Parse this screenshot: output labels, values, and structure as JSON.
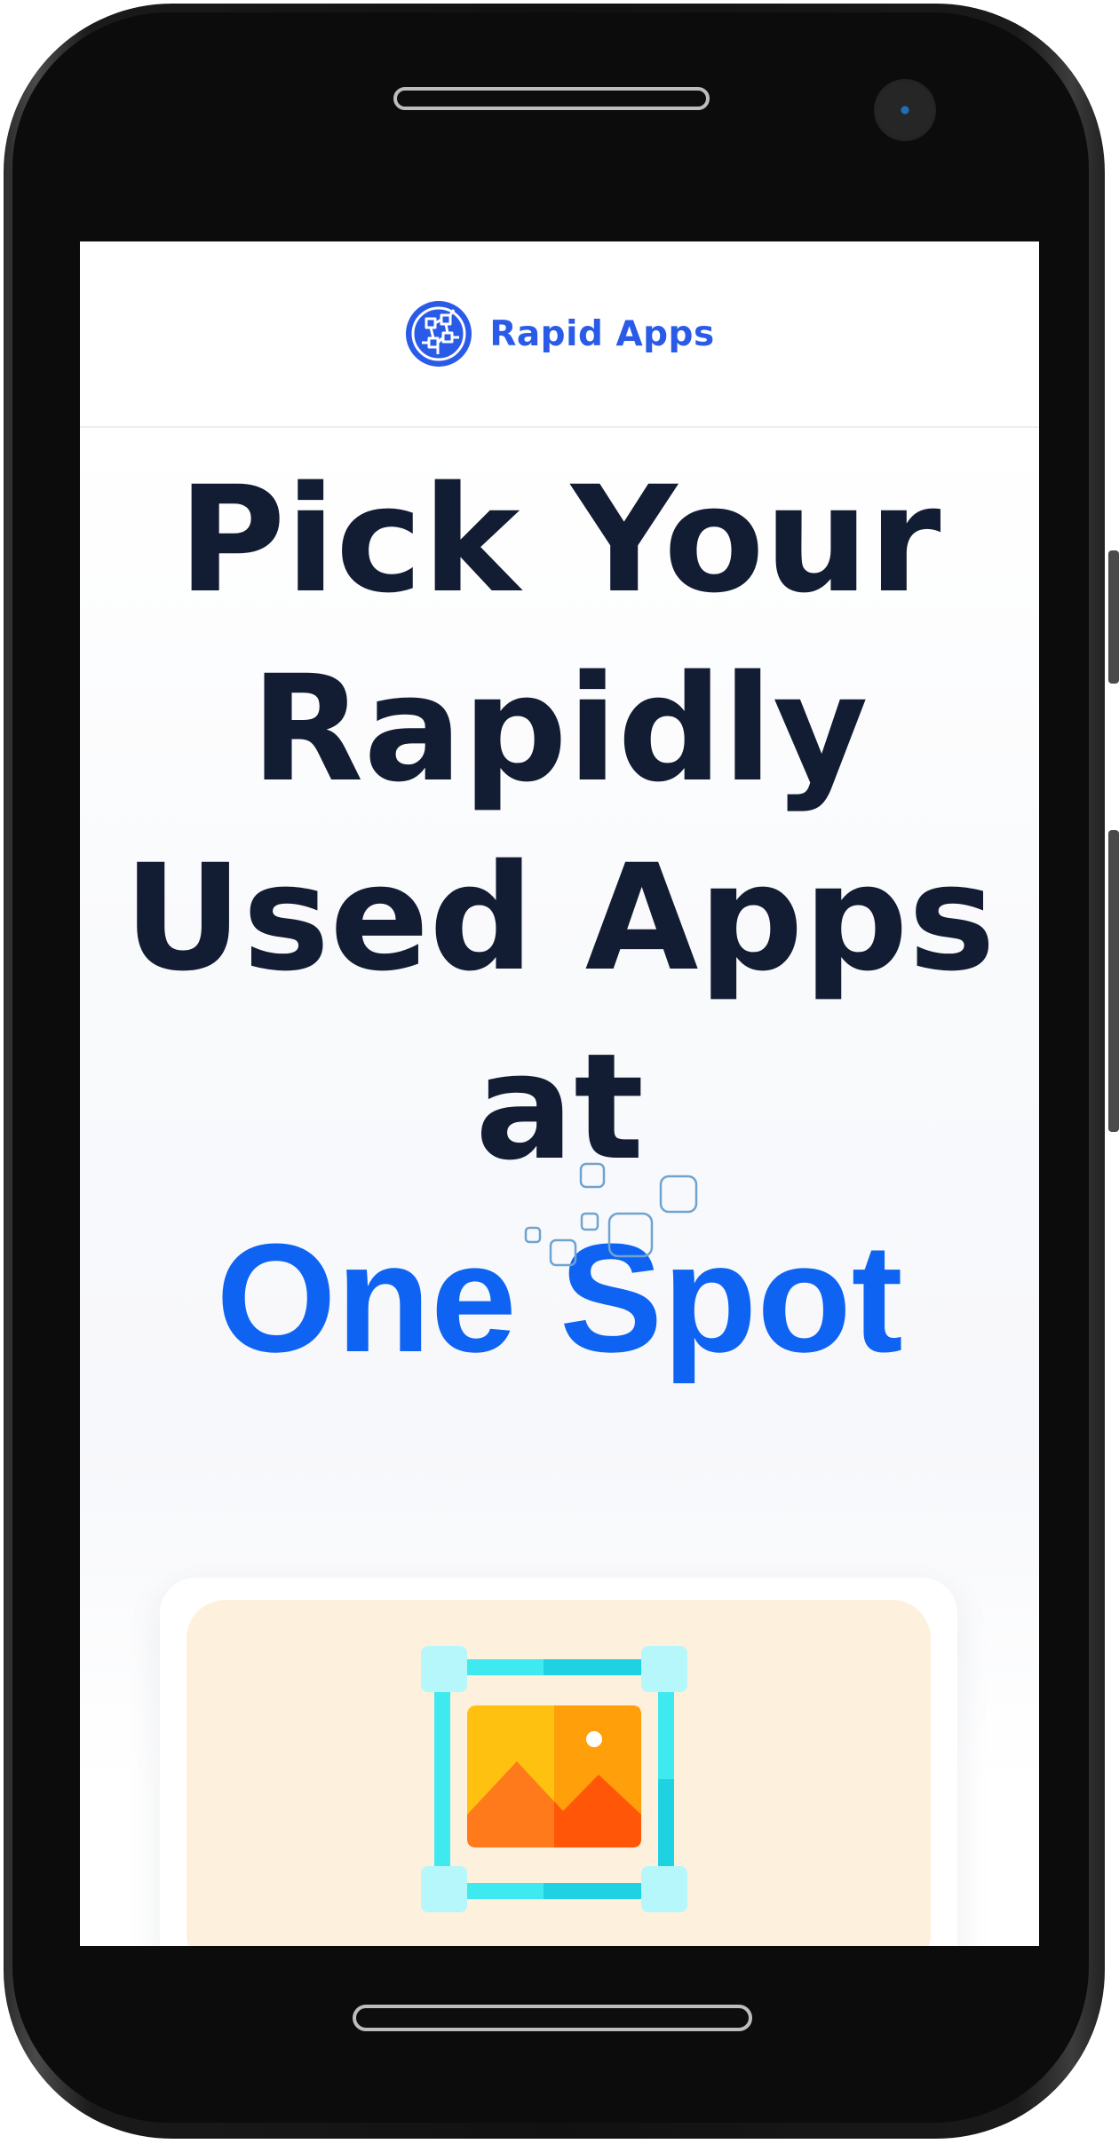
{
  "brand": {
    "name": "Rapid Apps",
    "logo_icon": "circuit-globe-icon",
    "color": "#2a5be8"
  },
  "hero": {
    "headline_lines": [
      "Pick Your",
      "Rapidly",
      "Used Apps",
      "at"
    ],
    "highlight": "One Spot",
    "headline_color": "#121d33",
    "highlight_color": "#0e63f2"
  },
  "feature_card": {
    "icon": "image-edit-icon",
    "background": "#fdf0dc"
  }
}
